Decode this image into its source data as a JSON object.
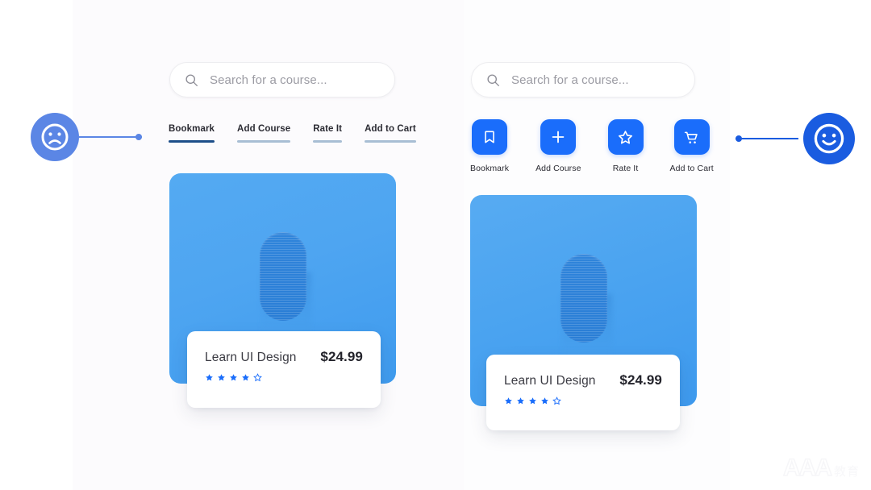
{
  "colors": {
    "sad_face_blue": "#5b86e5",
    "happy_face_blue": "#1a5ce0",
    "icon_button_blue": "#1a6dfb",
    "active_underline": "#1d4e89",
    "inactive_underline": "#a8bed4",
    "thumb_blue": "#4aa3f0",
    "capsule_blue": "#2d81d8",
    "star_filled": "#1a6dfb",
    "star_empty": "#1a6dfb"
  },
  "left_variant": {
    "marker": {
      "face_icon": "sad-face-icon",
      "mood": "sad"
    },
    "search": {
      "icon": "search-icon",
      "placeholder": "Search for a course...",
      "value": ""
    },
    "actions": [
      {
        "label": "Bookmark",
        "state": "active"
      },
      {
        "label": "Add Course",
        "state": "inactive"
      },
      {
        "label": "Rate It",
        "state": "inactive"
      },
      {
        "label": "Add to Cart",
        "state": "inactive"
      }
    ],
    "product": {
      "thumbnail_alt": "course-thumbnail",
      "title": "Learn UI Design",
      "price": "$24.99",
      "rating": 4,
      "rating_max": 5
    }
  },
  "right_variant": {
    "marker": {
      "face_icon": "happy-face-icon",
      "mood": "happy"
    },
    "search": {
      "icon": "search-icon",
      "placeholder": "Search for a course...",
      "value": ""
    },
    "actions": [
      {
        "label": "Bookmark",
        "icon": "bookmark-icon"
      },
      {
        "label": "Add Course",
        "icon": "plus-icon"
      },
      {
        "label": "Rate It",
        "icon": "star-icon"
      },
      {
        "label": "Add to Cart",
        "icon": "cart-icon"
      }
    ],
    "product": {
      "thumbnail_alt": "course-thumbnail",
      "title": "Learn UI Design",
      "price": "$24.99",
      "rating": 4,
      "rating_max": 5
    }
  },
  "watermark": {
    "primary": "AAA",
    "secondary": "教育"
  }
}
